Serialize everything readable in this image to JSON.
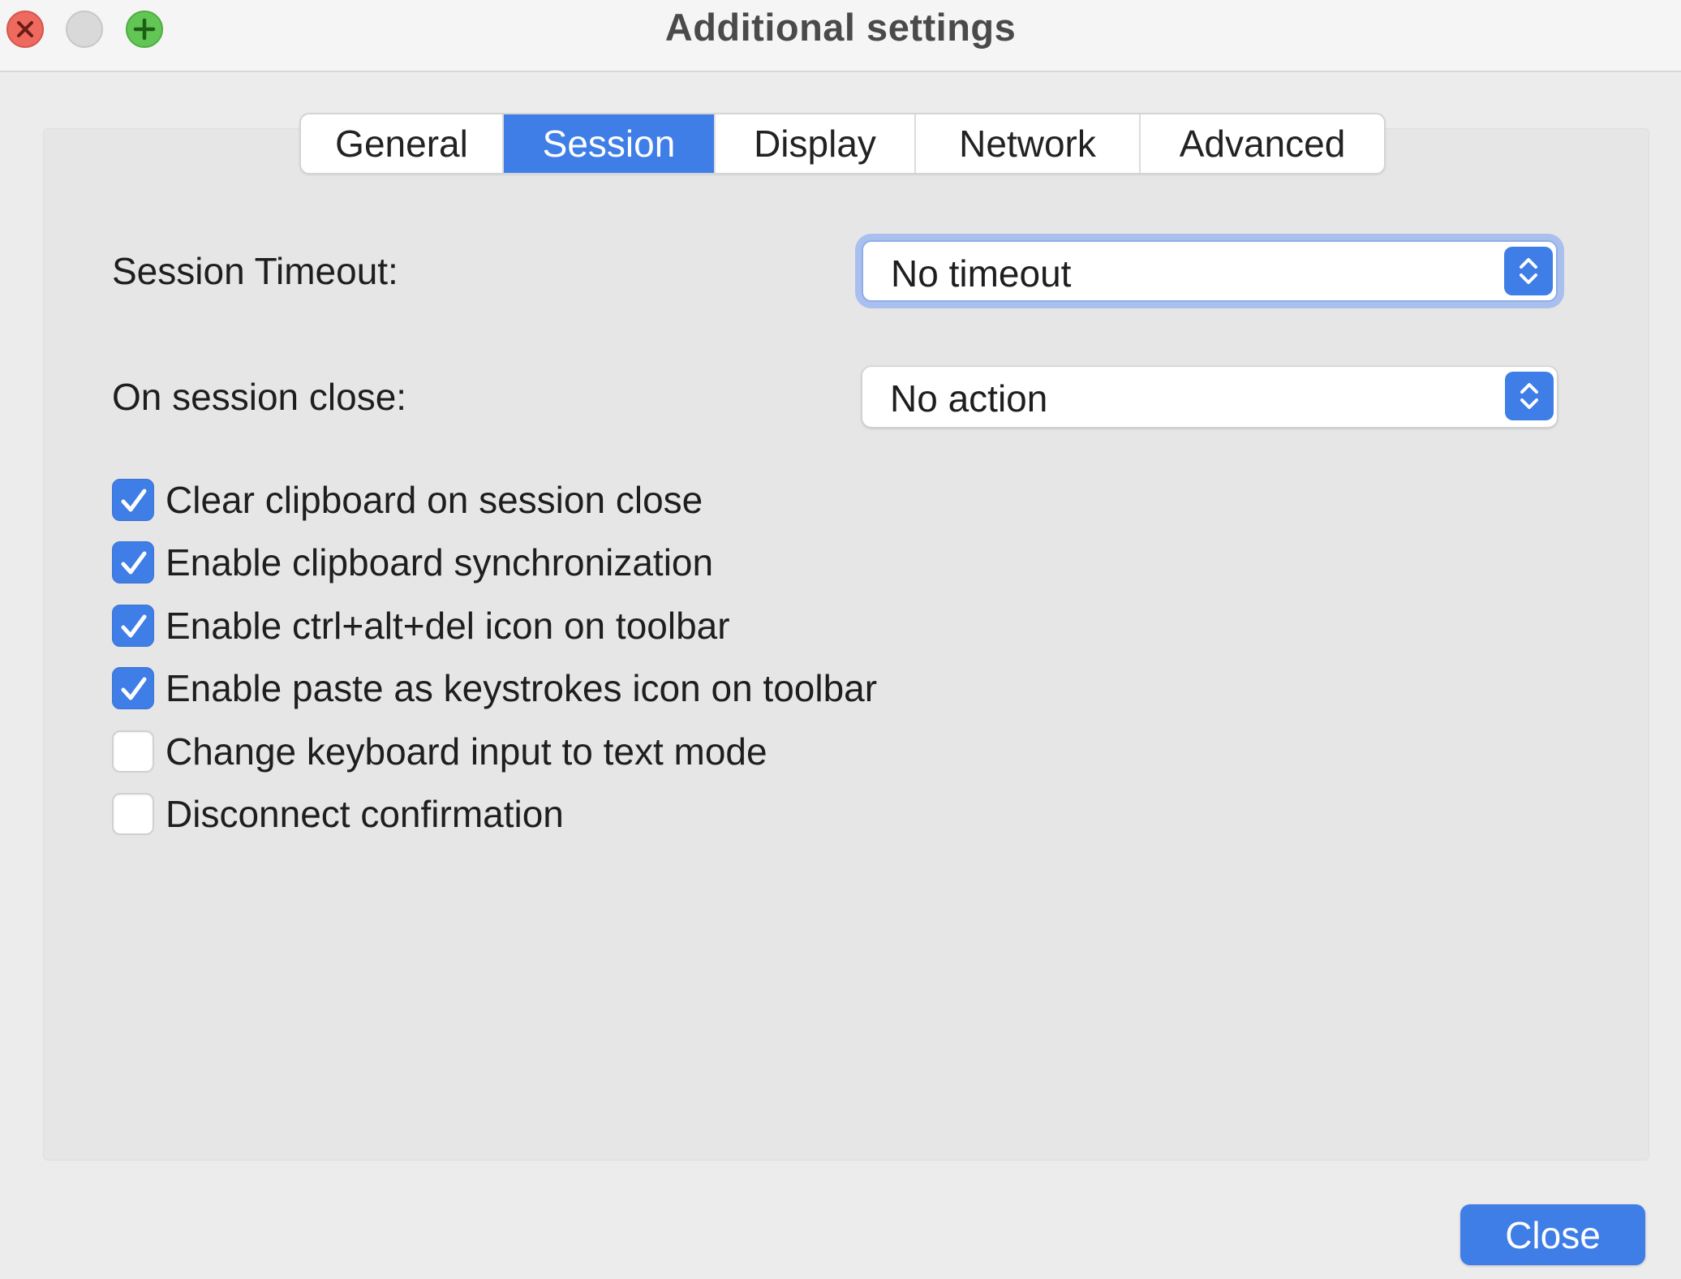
{
  "window": {
    "title": "Additional settings"
  },
  "tabs": [
    {
      "label": "General",
      "active": false
    },
    {
      "label": "Session",
      "active": true
    },
    {
      "label": "Display",
      "active": false
    },
    {
      "label": "Network",
      "active": false
    },
    {
      "label": "Advanced",
      "active": false
    }
  ],
  "session": {
    "timeout_label": "Session Timeout:",
    "timeout_value": "No timeout",
    "on_close_label": "On session close:",
    "on_close_value": "No action",
    "options": [
      {
        "label": "Clear clipboard on session close",
        "checked": true
      },
      {
        "label": "Enable clipboard synchronization",
        "checked": true
      },
      {
        "label": "Enable ctrl+alt+del icon on toolbar",
        "checked": true
      },
      {
        "label": "Enable paste as keystrokes icon on toolbar",
        "checked": true
      },
      {
        "label": "Change keyboard input to text mode",
        "checked": false
      },
      {
        "label": "Disconnect confirmation",
        "checked": false
      }
    ]
  },
  "footer": {
    "close_label": "Close"
  },
  "colors": {
    "accent": "#3e7ee6",
    "traffic_close": "#ee6a5f",
    "traffic_zoom": "#62c655"
  }
}
